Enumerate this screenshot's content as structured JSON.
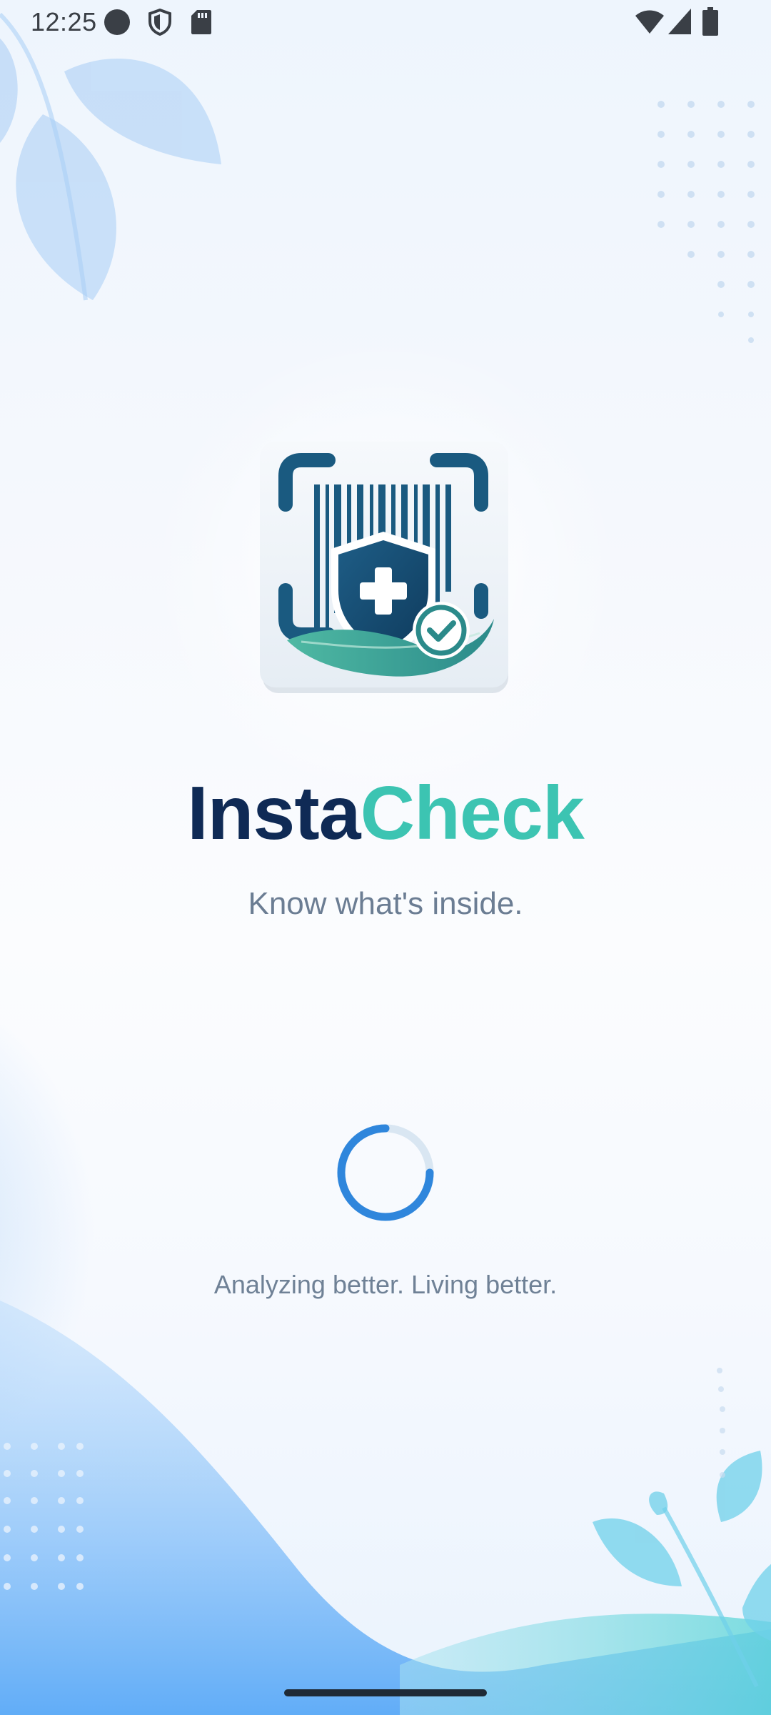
{
  "status_bar": {
    "time": "12:25",
    "left_icons": [
      "record-dot-icon",
      "shield-icon",
      "sd-card-icon"
    ],
    "right_icons": [
      "wifi-icon",
      "cellular-signal-icon",
      "battery-icon"
    ]
  },
  "splash": {
    "logo_icon": "barcode-shield-check-icon",
    "title_part1": "Insta",
    "title_part2": "Check",
    "tagline": "Know what's inside.",
    "loading_indicator": "circular-progress-spinner",
    "subtitle": "Analyzing better. Living better."
  },
  "colors": {
    "title_dark": "#0f2a55",
    "title_accent": "#3cc4b2",
    "spinner": "#2f86dc",
    "text_muted": "#6b7d93"
  }
}
